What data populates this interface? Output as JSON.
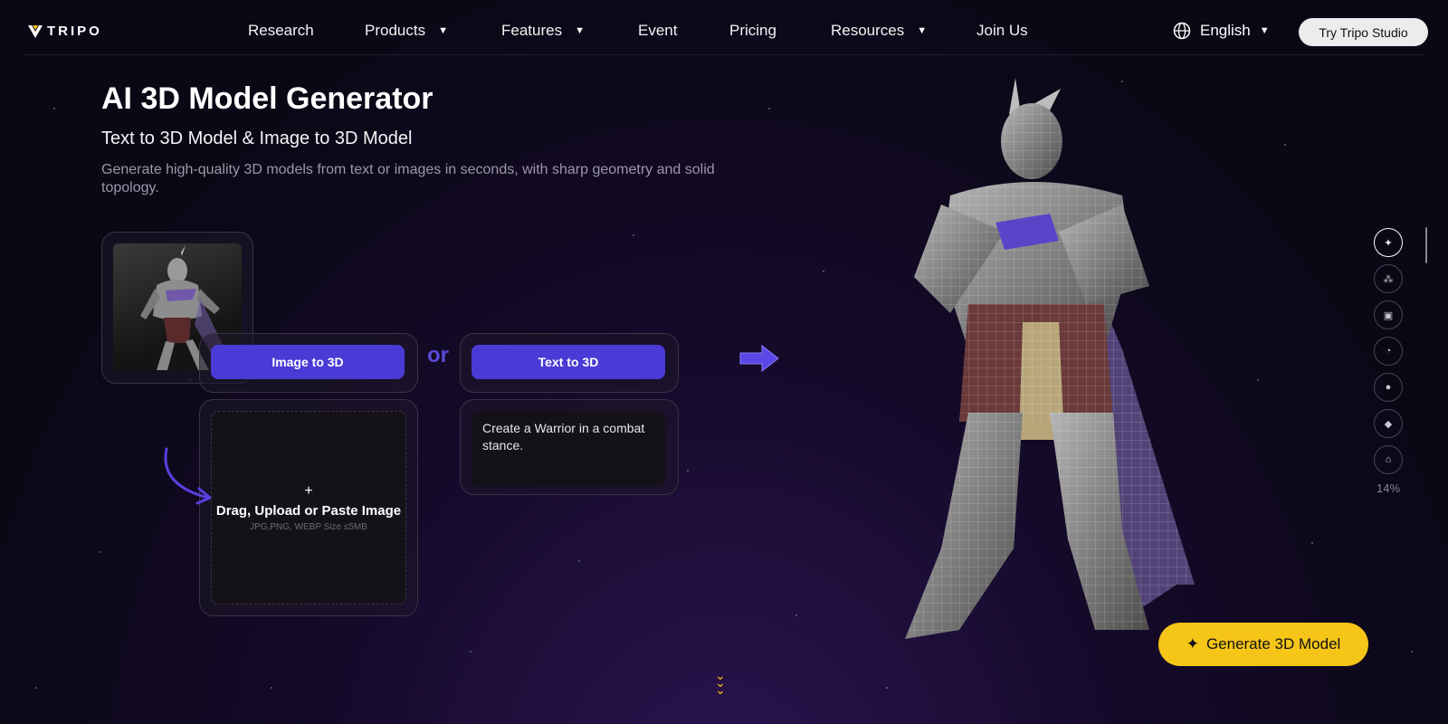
{
  "header": {
    "logo_text": "TRIPO",
    "nav": [
      {
        "label": "Research",
        "dropdown": false
      },
      {
        "label": "Products",
        "dropdown": true
      },
      {
        "label": "Features",
        "dropdown": true
      },
      {
        "label": "Event",
        "dropdown": false
      },
      {
        "label": "Pricing",
        "dropdown": false
      },
      {
        "label": "Resources",
        "dropdown": true
      },
      {
        "label": "Join Us",
        "dropdown": false
      }
    ],
    "language": "English",
    "cta_label": "Try Tripo Studio"
  },
  "hero": {
    "title": "AI 3D Model Generator",
    "subtitle": "Text to 3D Model & Image to 3D Model",
    "description": "Generate high-quality 3D models from text or images in seconds, with sharp geometry and solid topology."
  },
  "demo": {
    "image_to_3d_label": "Image to 3D",
    "or_label": "or",
    "text_to_3d_label": "Text to 3D",
    "upload_plus": "+",
    "upload_title": "Drag, Upload or Paste Image",
    "upload_hint": "JPG,PNG, WEBP Size ≤5MB",
    "prompt_text": "Create a Warrior in a combat stance."
  },
  "sidebar": {
    "icons": [
      "sparkle-icon",
      "nodes-icon",
      "box-icon",
      "pie-icon",
      "chat-icon",
      "cube-icon",
      "lamp-icon"
    ],
    "progress_label": "14%"
  },
  "generate_label": "Generate 3D Model",
  "colors": {
    "accent_purple": "#4a3bd6",
    "accent_yellow": "#f5c518",
    "background": "#0b0816"
  }
}
